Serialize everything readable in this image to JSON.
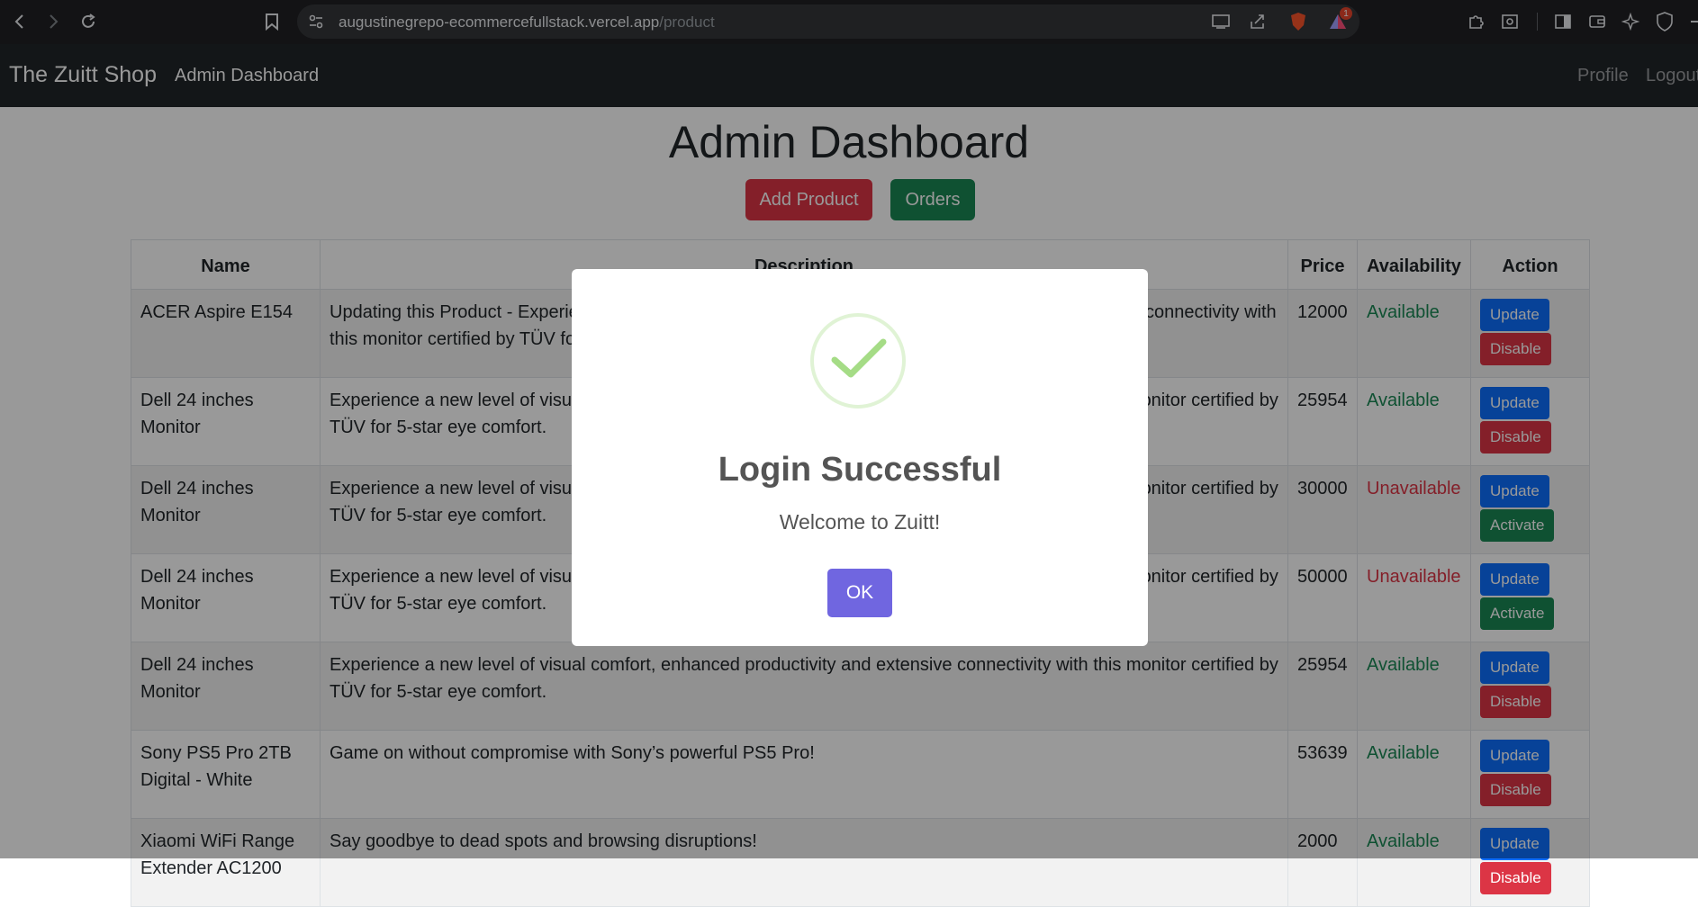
{
  "browser": {
    "url_host": "augustinegrepo-ecommercefullstack.vercel.app",
    "url_path": "/product",
    "notification_count": "1"
  },
  "navbar": {
    "brand": "The Zuitt Shop",
    "links": [
      "Admin Dashboard"
    ],
    "right_links": [
      "Profile",
      "Logout"
    ]
  },
  "page": {
    "title": "Admin Dashboard",
    "add_product_label": "Add Product",
    "orders_label": "Orders"
  },
  "table": {
    "headers": [
      "Name",
      "Description",
      "Price",
      "Availability",
      "Action"
    ],
    "rows": [
      {
        "name": "ACER Aspire E154",
        "description": "Updating this Product - Experience a new level of visual comfort, enhanced productivity and extensive connectivity with this monitor certified by TÜV for 5-star eye comfort.",
        "price": "12000",
        "availability": "Available",
        "primary_action": "Update",
        "secondary_action": "Disable"
      },
      {
        "name": "Dell 24 inches Monitor",
        "description": "Experience a new level of visual comfort, enhanced productivity and extensive connectivity with this monitor certified by TÜV for 5-star eye comfort.",
        "price": "25954",
        "availability": "Available",
        "primary_action": "Update",
        "secondary_action": "Disable"
      },
      {
        "name": "Dell 24 inches Monitor",
        "description": "Experience a new level of visual comfort, enhanced productivity and extensive connectivity with this monitor certified by TÜV for 5-star eye comfort.",
        "price": "30000",
        "availability": "Unavailable",
        "primary_action": "Update",
        "secondary_action": "Activate"
      },
      {
        "name": "Dell 24 inches Monitor",
        "description": "Experience a new level of visual comfort, enhanced productivity and extensive connectivity with this monitor certified by TÜV for 5-star eye comfort.",
        "price": "50000",
        "availability": "Unavailable",
        "primary_action": "Update",
        "secondary_action": "Activate"
      },
      {
        "name": "Dell 24 inches Monitor",
        "description": "Experience a new level of visual comfort, enhanced productivity and extensive connectivity with this monitor certified by TÜV for 5-star eye comfort.",
        "price": "25954",
        "availability": "Available",
        "primary_action": "Update",
        "secondary_action": "Disable"
      },
      {
        "name": "Sony PS5 Pro 2TB Digital - White",
        "description": "Game on without compromise with Sony’s powerful PS5 Pro!",
        "price": "53639",
        "availability": "Available",
        "primary_action": "Update",
        "secondary_action": "Disable"
      },
      {
        "name": "Xiaomi WiFi Range Extender AC1200",
        "description": "Say goodbye to dead spots and browsing disruptions!",
        "price": "2000",
        "availability": "Available",
        "primary_action": "Update",
        "secondary_action": "Disable"
      }
    ]
  },
  "modal": {
    "title": "Login Successful",
    "text": "Welcome to Zuitt!",
    "ok_label": "OK"
  },
  "colors": {
    "available": "#198754",
    "unavailable": "#dc3545",
    "update": "#0d6efd",
    "disable": "#dc3545",
    "activate": "#198754",
    "ok_button": "#7066e0",
    "check": "#a5dc86"
  }
}
